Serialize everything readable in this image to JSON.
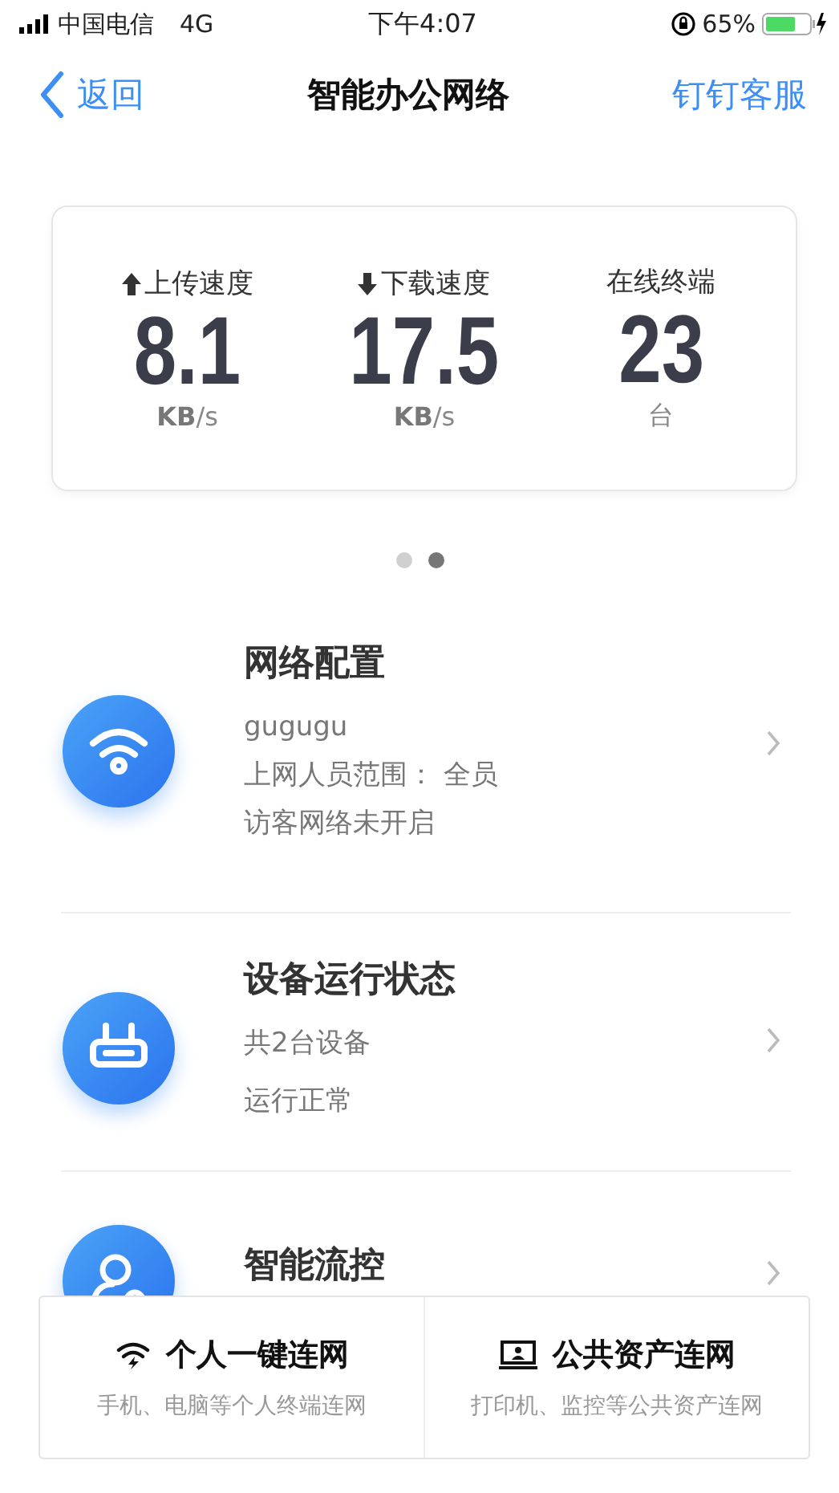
{
  "status_bar": {
    "carrier": "中国电信",
    "network": "4G",
    "time": "下午4:07",
    "battery": "65%"
  },
  "nav": {
    "back": "返回",
    "title": "智能办公网络",
    "action": "钉钉客服"
  },
  "stats": [
    {
      "kind": "upload",
      "label": "上传速度",
      "value": "8.1",
      "unit_bold": "KB",
      "unit_rest": "/s"
    },
    {
      "kind": "download",
      "label": "下载速度",
      "value": "17.5",
      "unit_bold": "KB",
      "unit_rest": "/s"
    },
    {
      "kind": "count",
      "label": "在线终端",
      "value": "23",
      "unit_rest": "台"
    }
  ],
  "pager": [
    {
      "selected": false
    },
    {
      "selected": true
    }
  ],
  "items": [
    {
      "title": "网络配置",
      "lines": [
        "gugugu",
        "上网人员范围： 全员",
        "访客网络未开启"
      ]
    },
    {
      "title": "设备运行状态",
      "lines": [
        "共2台设备",
        "运行正常"
      ]
    },
    {
      "title": "智能流控"
    }
  ],
  "bottom": [
    {
      "title": "个人一键连网",
      "subtitle": "手机、电脑等个人终端连网"
    },
    {
      "title": "公共资产连网",
      "subtitle": "打印机、监控等公共资产连网"
    }
  ]
}
